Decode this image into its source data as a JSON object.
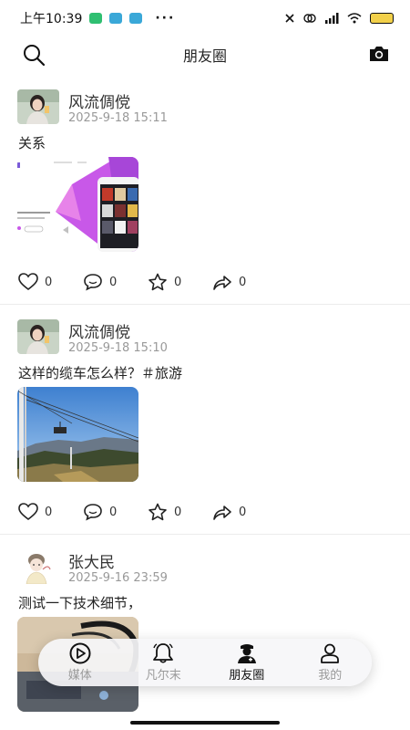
{
  "status_bar": {
    "time": "上午10:39",
    "dots": "···"
  },
  "header": {
    "title": "朋友圈"
  },
  "posts": [
    {
      "author": "风流倜傥",
      "time": "2025-9-18 15:11",
      "text": "关系",
      "likes": "0",
      "comments": "0",
      "favorites": "0",
      "shares": "0"
    },
    {
      "author": "风流倜傥",
      "time": "2025-9-18 15:10",
      "text": "这样的缆车怎么样？＃旅游",
      "likes": "0",
      "comments": "0",
      "favorites": "0",
      "shares": "0"
    },
    {
      "author": "张大民",
      "time": "2025-9-16 23:59",
      "text": "测试一下技术细节，"
    }
  ],
  "nav": [
    {
      "label": "媒体",
      "icon": "play-circle-icon"
    },
    {
      "label": "凡尔末",
      "icon": "bell-icon"
    },
    {
      "label": "朋友圈",
      "icon": "doctor-icon"
    },
    {
      "label": "我的",
      "icon": "person-icon"
    }
  ],
  "colors": {
    "accent": "#111111",
    "inactive": "#9a9a9a",
    "time_gray": "#999999"
  }
}
